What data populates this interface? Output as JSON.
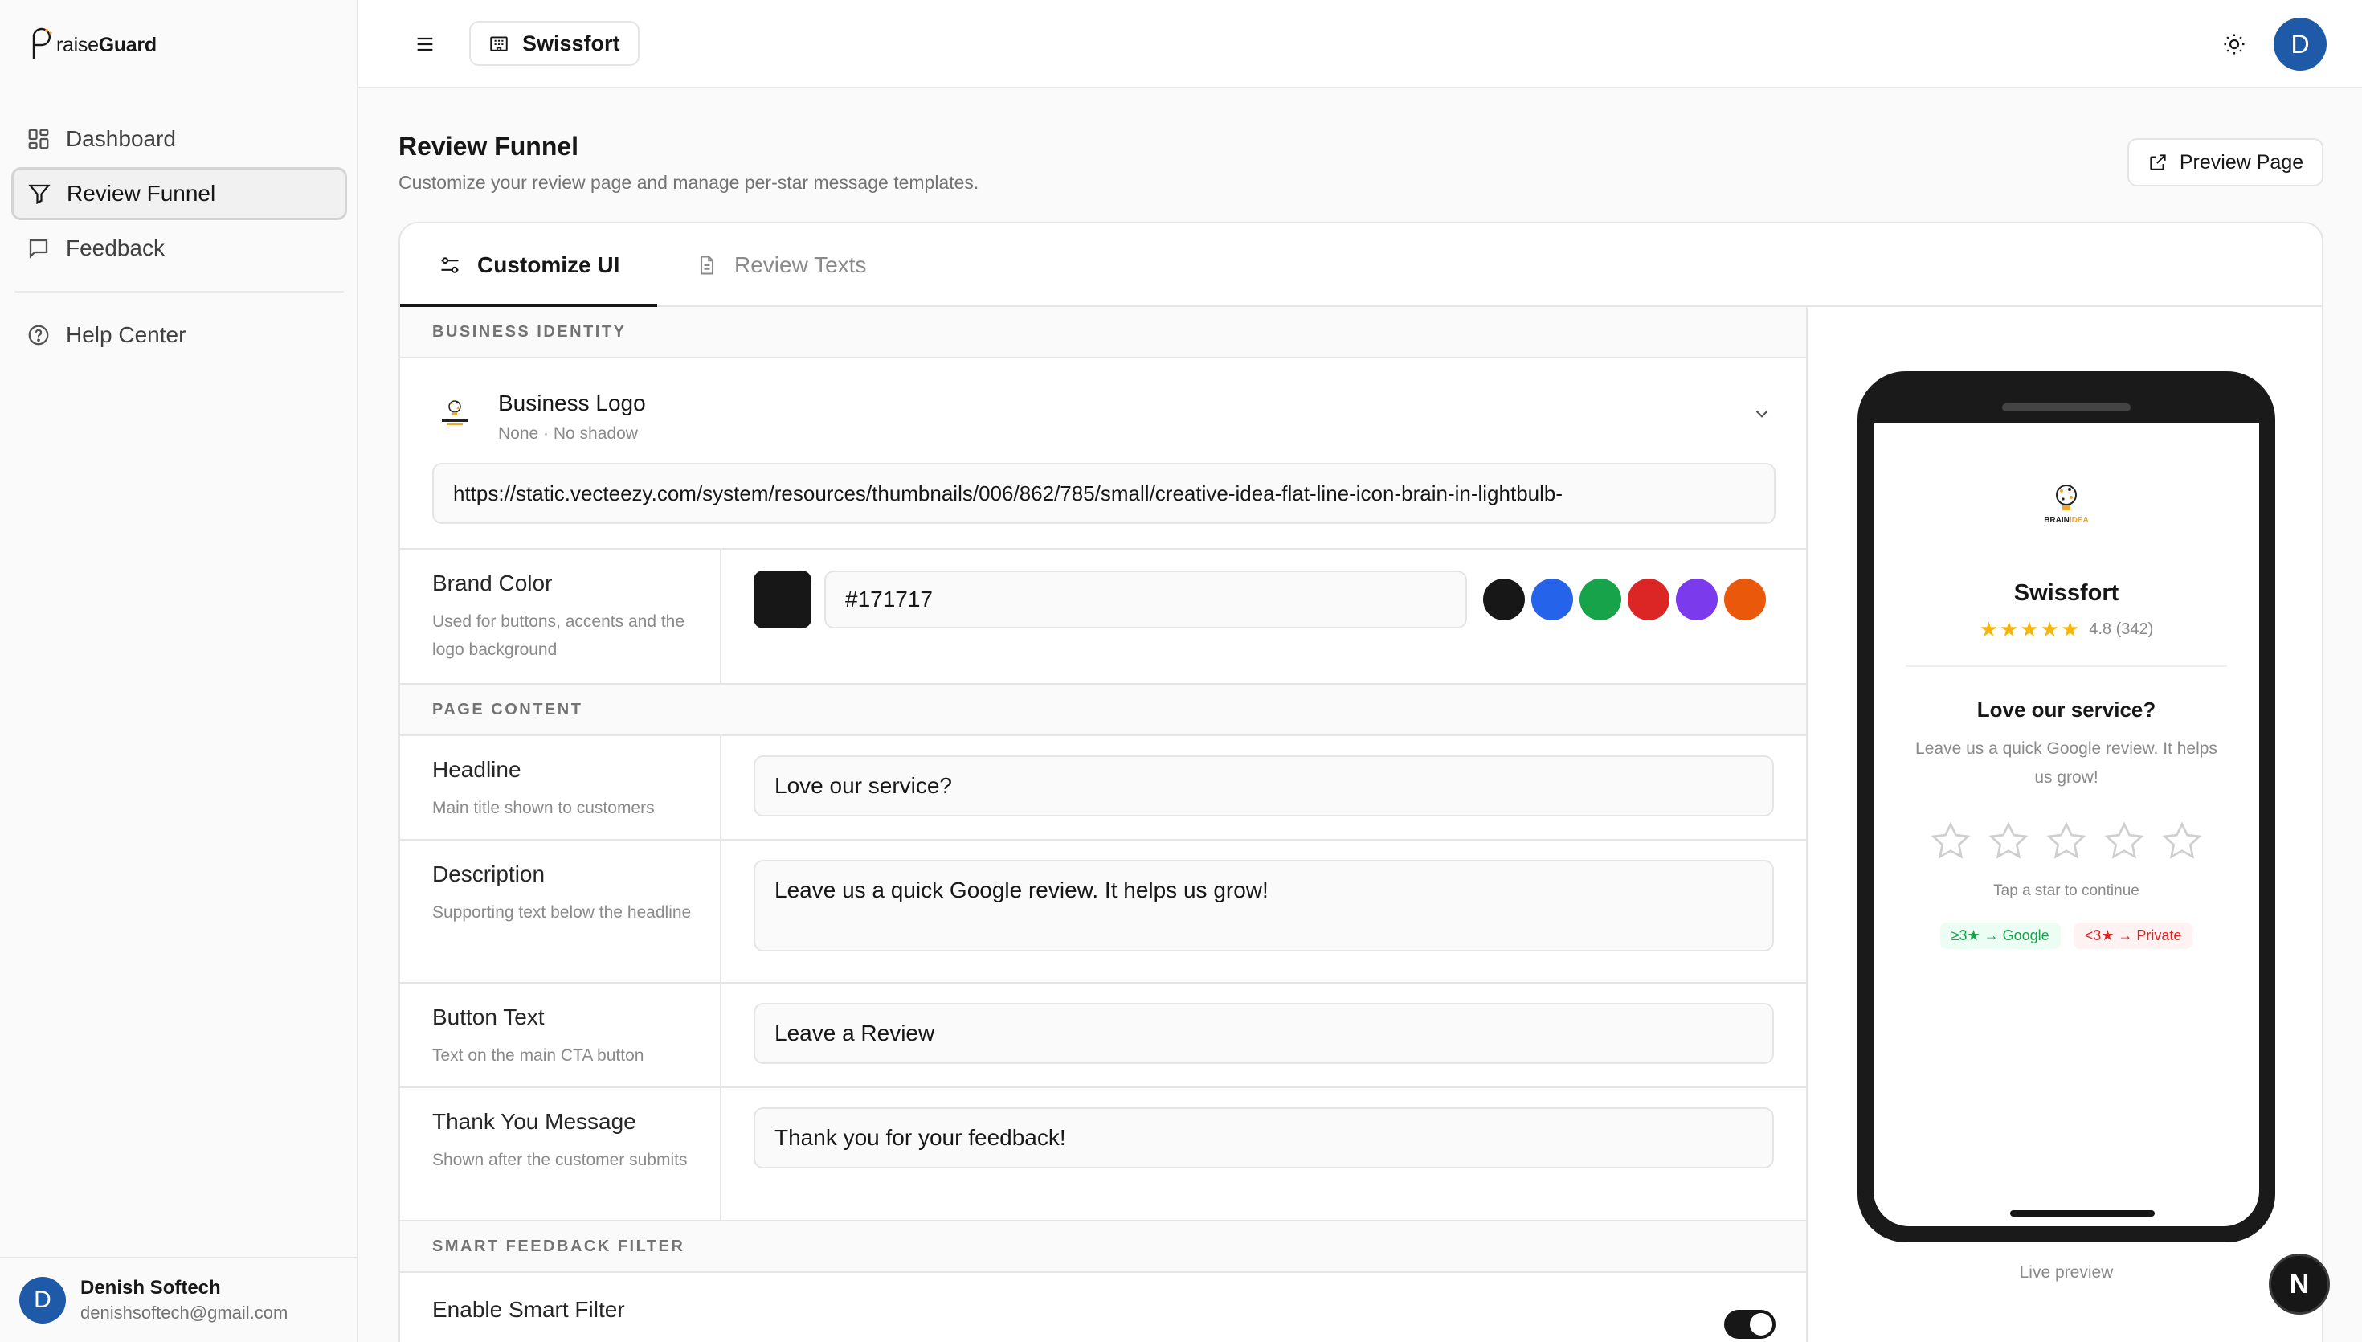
{
  "brand": {
    "logo_initial": "P",
    "logo_rest": "raise",
    "logo_bold": "Guard"
  },
  "sidebar": {
    "items": [
      {
        "label": "Dashboard",
        "icon": "grid-icon"
      },
      {
        "label": "Review Funnel",
        "icon": "filter-icon",
        "active": true
      },
      {
        "label": "Feedback",
        "icon": "message-icon"
      },
      {
        "label": "Help Center",
        "icon": "help-icon"
      }
    ],
    "user": {
      "initial": "D",
      "name": "Denish Softech",
      "email": "denishsoftech@gmail.com"
    }
  },
  "header": {
    "business_name": "Swissfort",
    "avatar_initial": "D"
  },
  "page": {
    "title": "Review Funnel",
    "subtitle": "Customize your review page and manage per-star message templates.",
    "preview_button": "Preview Page"
  },
  "tabs": [
    {
      "label": "Customize UI",
      "active": true
    },
    {
      "label": "Review Texts",
      "active": false
    }
  ],
  "sections": {
    "identity": "BUSINESS IDENTITY",
    "content": "PAGE CONTENT",
    "filter": "SMART FEEDBACK FILTER"
  },
  "logo_block": {
    "title": "Business Logo",
    "subtitle": "None · No shadow",
    "url": "https://static.vecteezy.com/system/resources/thumbnails/006/862/785/small/creative-idea-flat-line-icon-brain-in-lightbulb-"
  },
  "brand_color": {
    "label": "Brand Color",
    "desc": "Used for buttons, accents and the logo background",
    "value": "#171717",
    "presets": [
      "#171717",
      "#2563eb",
      "#16a34a",
      "#dc2626",
      "#7c3aed",
      "#ea580c"
    ]
  },
  "fields": {
    "headline": {
      "label": "Headline",
      "desc": "Main title shown to customers",
      "value": "Love our service?"
    },
    "description": {
      "label": "Description",
      "desc": "Supporting text below the headline",
      "value": "Leave us a quick Google review. It helps us grow!"
    },
    "button_text": {
      "label": "Button Text",
      "desc": "Text on the main CTA button",
      "value": "Leave a Review"
    },
    "thank_you": {
      "label": "Thank You Message",
      "desc": "Shown after the customer submits",
      "value": "Thank you for your feedback!"
    }
  },
  "smart_filter": {
    "label": "Enable Smart Filter",
    "enabled": true
  },
  "preview": {
    "business_name": "Swissfort",
    "stars_display": "★★★★★",
    "rating_text": "4.8 (342)",
    "headline": "Love our service?",
    "description": "Leave us a quick Google review. It helps us grow!",
    "tap_hint": "Tap a star to continue",
    "badge_google": "≥3★ → Google",
    "badge_private": "<3★ → Private",
    "caption": "Live preview",
    "logo_word_1": "BRAIN",
    "logo_word_2": "IDEA"
  },
  "floating_button": "N"
}
